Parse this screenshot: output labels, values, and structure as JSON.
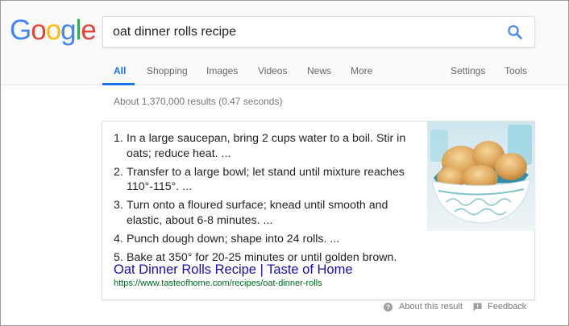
{
  "logo": {
    "letters": [
      "G",
      "o",
      "o",
      "g",
      "l",
      "e"
    ],
    "colors": [
      "#4285F4",
      "#EA4335",
      "#FBBC05",
      "#4285F4",
      "#34A853",
      "#EA4335"
    ]
  },
  "search": {
    "query": "oat dinner rolls recipe",
    "icon": "magnifier-icon",
    "accent": "#4285F4"
  },
  "tabs": {
    "all": "All",
    "shopping": "Shopping",
    "images": "Images",
    "videos": "Videos",
    "news": "News",
    "more": "More",
    "settings": "Settings",
    "tools": "Tools"
  },
  "stats": "About 1,370,000 results (0.47 seconds)",
  "snippet": {
    "steps": [
      {
        "num": "1.",
        "text": "In a large saucepan, bring 2 cups water to a boil. Stir in oats; reduce heat. ..."
      },
      {
        "num": "2.",
        "text": "Transfer to a large bowl; let stand until mixture reaches 110°-115°. ..."
      },
      {
        "num": "3.",
        "text": "Turn onto a floured surface; knead until smooth and elastic, about 6-8 minutes. ..."
      },
      {
        "num": "4.",
        "text": "Punch dough down; shape into 24 rolls. ..."
      },
      {
        "num": "5.",
        "text": "Bake at 350° for 20-25 minutes or until golden brown."
      }
    ],
    "title": "Oat Dinner Rolls Recipe | Taste of Home",
    "url": "https://www.tasteofhome.com/recipes/oat-dinner-rolls",
    "image": "bread-rolls-in-bowl"
  },
  "footer": {
    "about": "About this result",
    "feedback": "Feedback"
  },
  "colors": {
    "link": "#1a0dab",
    "url": "#006621",
    "active_tab": "#1a73e8"
  }
}
